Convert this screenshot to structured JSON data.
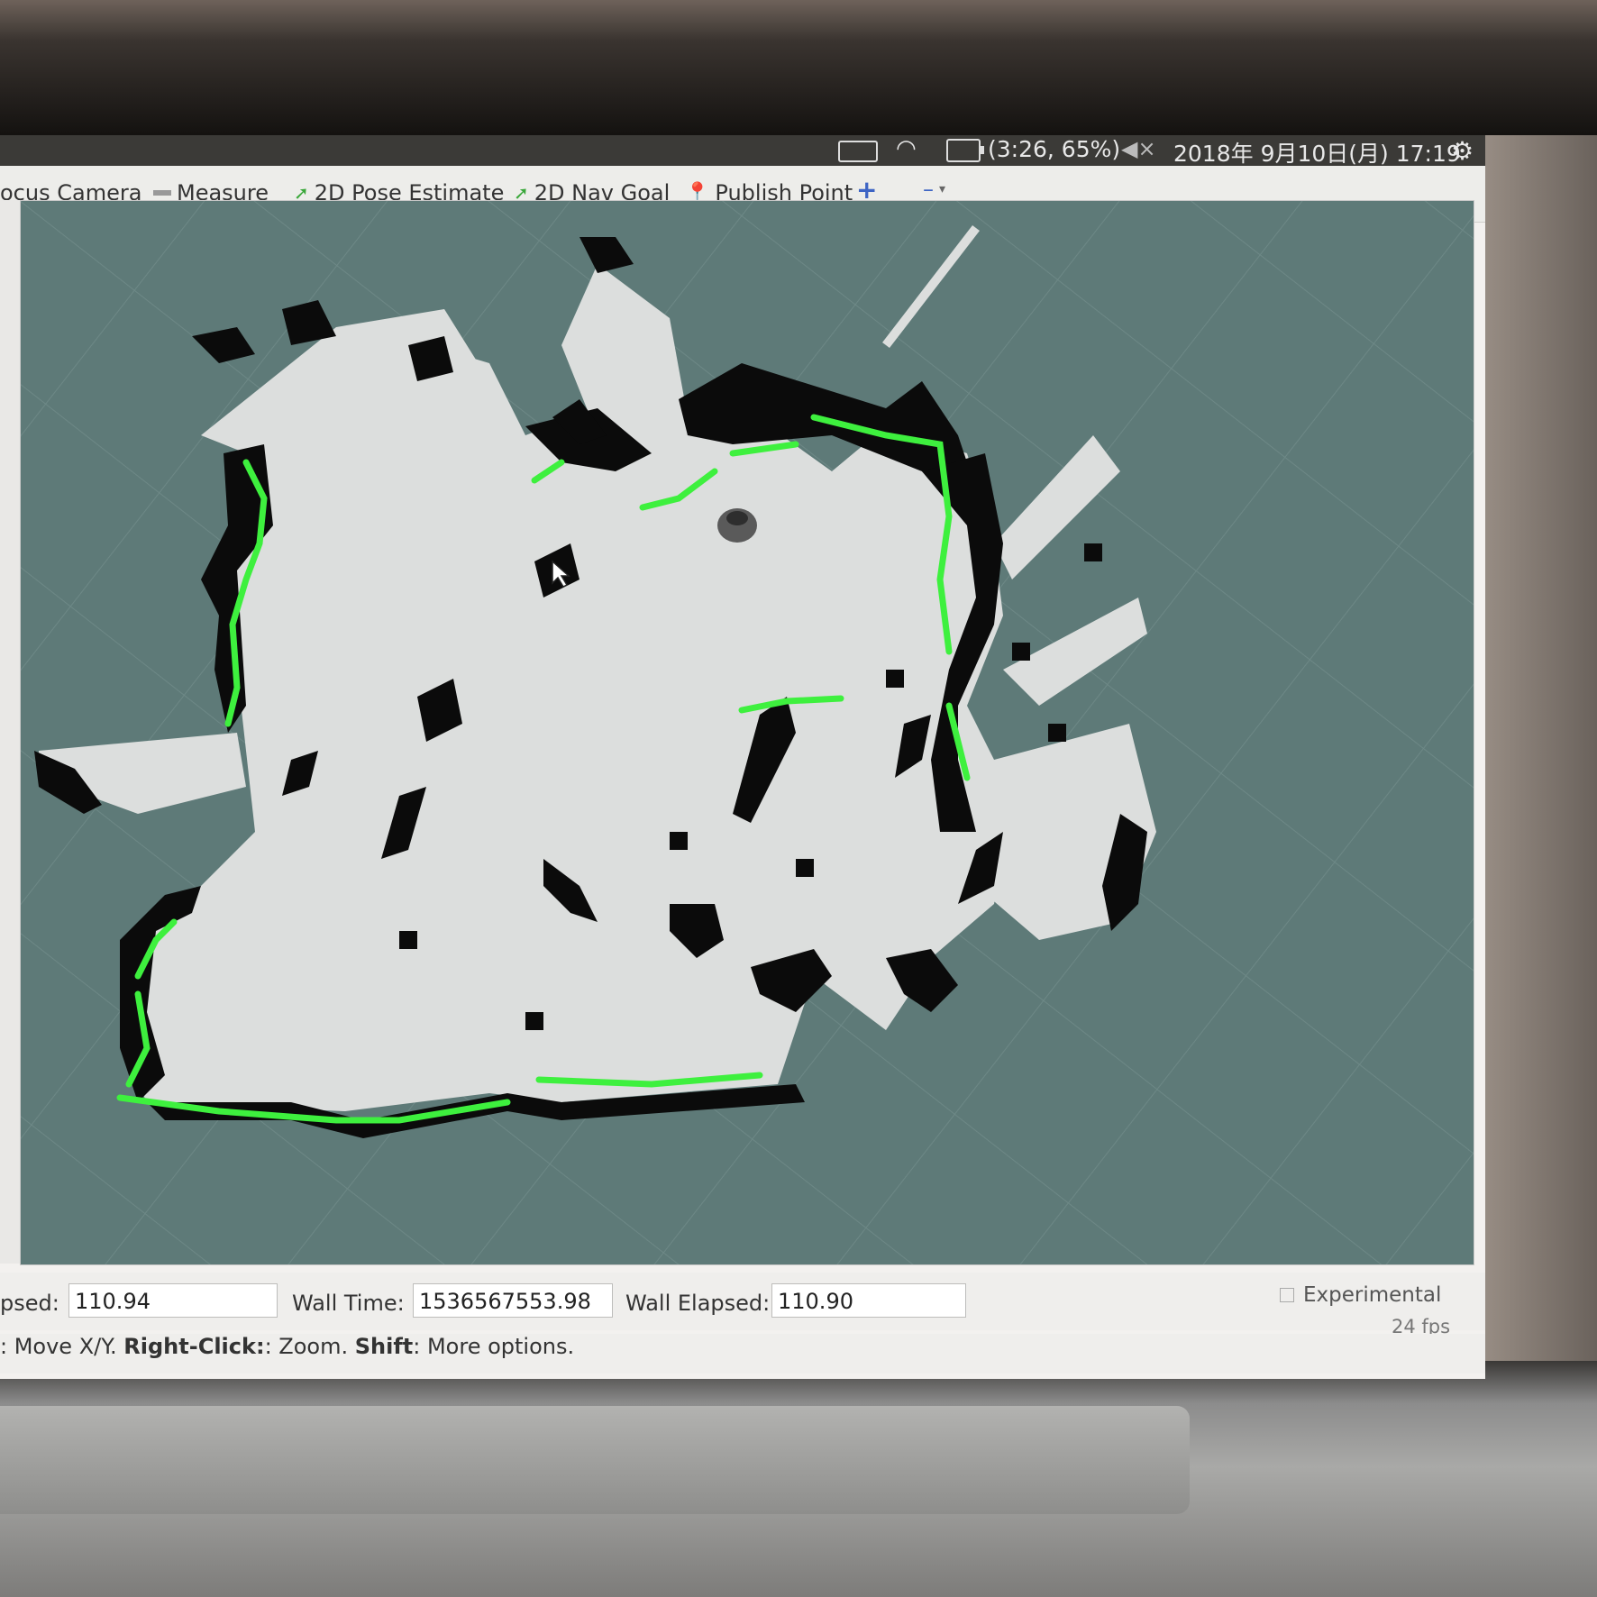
{
  "tray": {
    "battery": "(3:26, 65%)",
    "datetime": "2018年 9月10日(月) 17:19"
  },
  "toolbar": {
    "focus_camera": "ocus Camera",
    "measure": "Measure",
    "pose_estimate": "2D Pose Estimate",
    "nav_goal": "2D Nav Goal",
    "publish_point": "Publish Point"
  },
  "timebar": {
    "elapsed_label": "psed:",
    "elapsed_value": "110.94",
    "wall_time_label": "Wall Time:",
    "wall_time_value": "1536567553.98",
    "wall_elapsed_label": "Wall Elapsed:",
    "wall_elapsed_value": "110.90",
    "experimental_label": "Experimental",
    "fps": "24 fps"
  },
  "status": {
    "part1": ": Move X/Y. ",
    "right_click": "Right-Click:",
    "part2": ": Zoom. ",
    "shift": "Shift",
    "part3": ": More options."
  },
  "colors": {
    "background": "#5e7a78",
    "free_space": "#dcdedd",
    "obstacle": "#0b0b0b",
    "laser_scan": "#3ef03e",
    "robot": "#555555"
  }
}
